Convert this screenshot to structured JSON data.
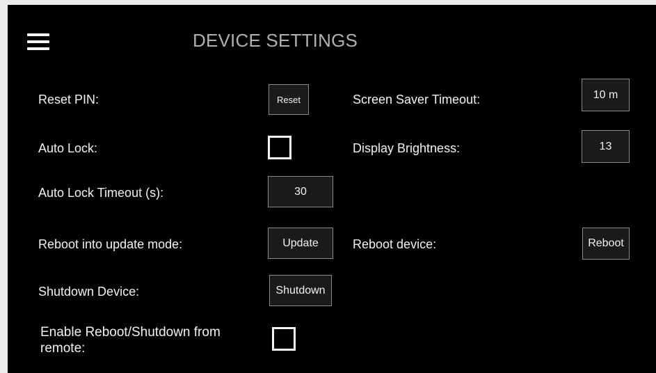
{
  "header": {
    "title": "DEVICE SETTINGS",
    "menu_icon": "hamburger-menu-icon"
  },
  "left": {
    "reset_pin_label": "Reset PIN:",
    "reset_button": "Reset",
    "auto_lock_label": "Auto Lock:",
    "auto_lock_checked": false,
    "auto_lock_timeout_label": "Auto Lock Timeout (s):",
    "auto_lock_timeout_value": "30",
    "update_mode_label": "Reboot into update mode:",
    "update_button": "Update",
    "shutdown_label": "Shutdown Device:",
    "shutdown_button": "Shutdown",
    "remote_label": "Enable Reboot/Shutdown from remote:",
    "remote_checked": false
  },
  "right": {
    "screen_saver_label": "Screen Saver Timeout:",
    "screen_saver_value": "10 m",
    "brightness_label": "Display Brightness:",
    "brightness_value": "13",
    "reboot_label": "Reboot device:",
    "reboot_button": "Reboot"
  },
  "colors": {
    "background": "#000000",
    "text": "#f2f2f2",
    "title": "#b0b0b0",
    "button_border": "#8a8a8a"
  }
}
